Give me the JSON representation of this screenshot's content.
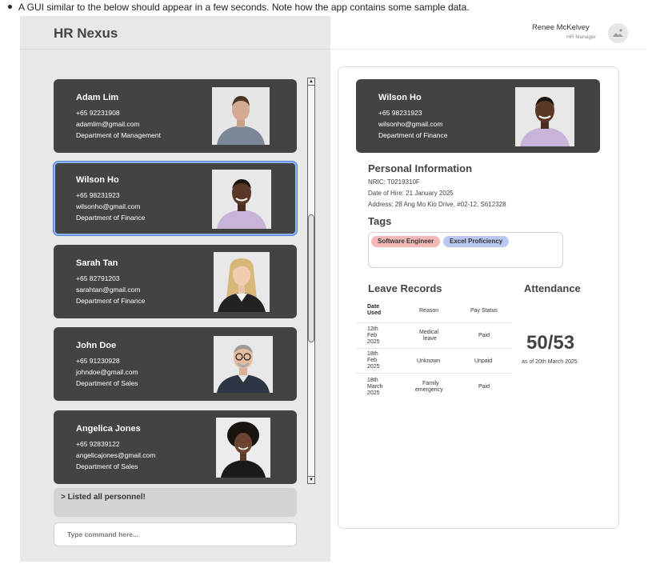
{
  "caption": "A GUI similar to the below should appear in a few seconds. Note how the app contains some sample data.",
  "app": {
    "title": "HR Nexus"
  },
  "user": {
    "name": "Renee McKelvey",
    "role": "HR Manager"
  },
  "personnel": [
    {
      "name": "Adam Lim",
      "phone": "+65 92231908",
      "email": "adamlim@gmail.com",
      "department": "Department of Management"
    },
    {
      "name": "Wilson Ho",
      "phone": "+65 98231923",
      "email": "wilsonho@gmail.com",
      "department": "Department of Finance"
    },
    {
      "name": "Sarah Tan",
      "phone": "+65 82791203",
      "email": "sarahtan@gmail.com",
      "department": "Department of Finance"
    },
    {
      "name": "John Doe",
      "phone": "+65 91230928",
      "email": "johndoe@gmail.com",
      "department": "Department of Sales"
    },
    {
      "name": "Angelica Jones",
      "phone": "+65 92839122",
      "email": "angelicajones@gmail.com",
      "department": "Department of Sales"
    }
  ],
  "selected_index": 1,
  "result_message": "> Listed all personnel!",
  "command": {
    "placeholder": "Type command here..."
  },
  "detail": {
    "name": "Wilson Ho",
    "phone": "+65 98231923",
    "email": "wilsonho@gmail.com",
    "department": "Department of Finance",
    "personal_info_title": "Personal Information",
    "nric": "NRIC: T0219310F",
    "hire_date": "Date of Hire: 21 January 2025",
    "address": "Address: 28 Ang Mo Kio Drive, #02-12, S612328",
    "tags_title": "Tags",
    "tags": [
      {
        "label": "Software Engineer",
        "color": "#f2b8b8"
      },
      {
        "label": "Excel Proficiency",
        "color": "#b8c8f0"
      }
    ],
    "leave_title": "Leave Records",
    "leave_headers": {
      "date": [
        "Date",
        "Used"
      ],
      "reason": "Reason",
      "pay": "Pay Status"
    },
    "leave_rows": [
      {
        "date": [
          "12th",
          "Feb",
          "2025"
        ],
        "reason": [
          "Medical",
          "leave"
        ],
        "pay": "Paid"
      },
      {
        "date": [
          "18th",
          "Feb",
          "2025"
        ],
        "reason": [
          "Unknown"
        ],
        "pay": "Unpaid"
      },
      {
        "date": [
          "18th",
          "March",
          "2025"
        ],
        "reason": [
          "Family",
          "emergency"
        ],
        "pay": "Paid"
      }
    ],
    "attendance_title": "Attendance",
    "attendance_value": "50/53",
    "attendance_note": "as of 20th March 2025"
  },
  "icons": {
    "avatar": "person-placeholder-icon",
    "scroll_up": "triangle-up-icon",
    "scroll_down": "triangle-down-icon"
  }
}
